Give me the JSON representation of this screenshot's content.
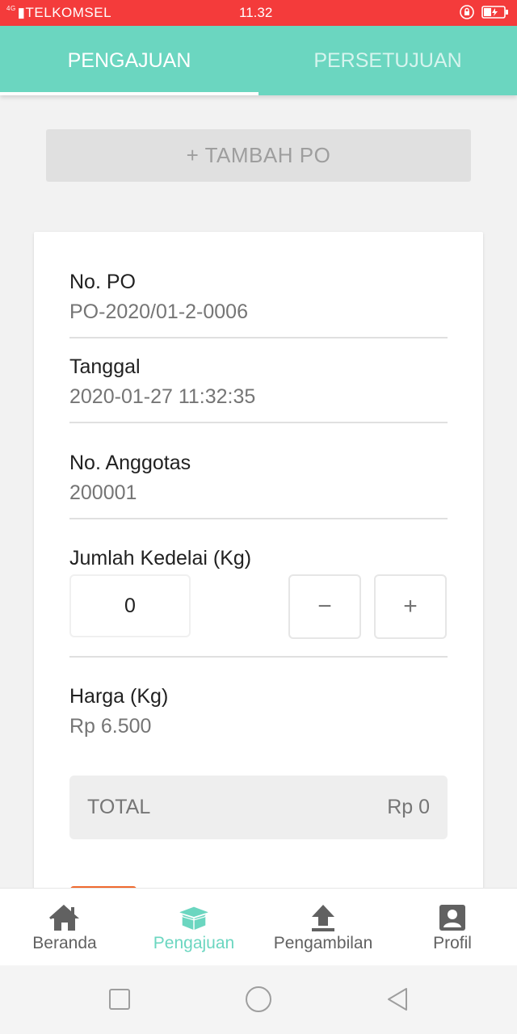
{
  "status_bar": {
    "network": "4G",
    "carrier": "TELKOMSEL",
    "time": "11.32"
  },
  "tabs": [
    {
      "label": "PENGAJUAN",
      "active": true
    },
    {
      "label": "PERSETUJUAN",
      "active": false
    }
  ],
  "add_po_label": "+ TAMBAH PO",
  "form": {
    "po": {
      "label": "No. PO",
      "value": "PO-2020/01-2-0006"
    },
    "date": {
      "label": "Tanggal",
      "value": "2020-01-27 11:32:35"
    },
    "member": {
      "label": "No. Anggotas",
      "value": "200001"
    },
    "quantity": {
      "label": "Jumlah Kedelai (Kg)",
      "value": "0",
      "minus": "−",
      "plus": "+"
    },
    "price": {
      "label": "Harga (Kg)",
      "value": "Rp 6.500"
    },
    "total": {
      "label": "TOTAL",
      "value": "Rp 0"
    }
  },
  "bottom_nav": [
    {
      "label": "Beranda",
      "icon": "home-icon",
      "active": false
    },
    {
      "label": "Pengajuan",
      "icon": "box-icon",
      "active": true
    },
    {
      "label": "Pengambilan",
      "icon": "upload-icon",
      "active": false
    },
    {
      "label": "Profil",
      "icon": "profile-icon",
      "active": false
    }
  ],
  "colors": {
    "status_bar": "#f43b3b",
    "accent": "#6bd6c0",
    "orange": "#ef6a2f"
  }
}
